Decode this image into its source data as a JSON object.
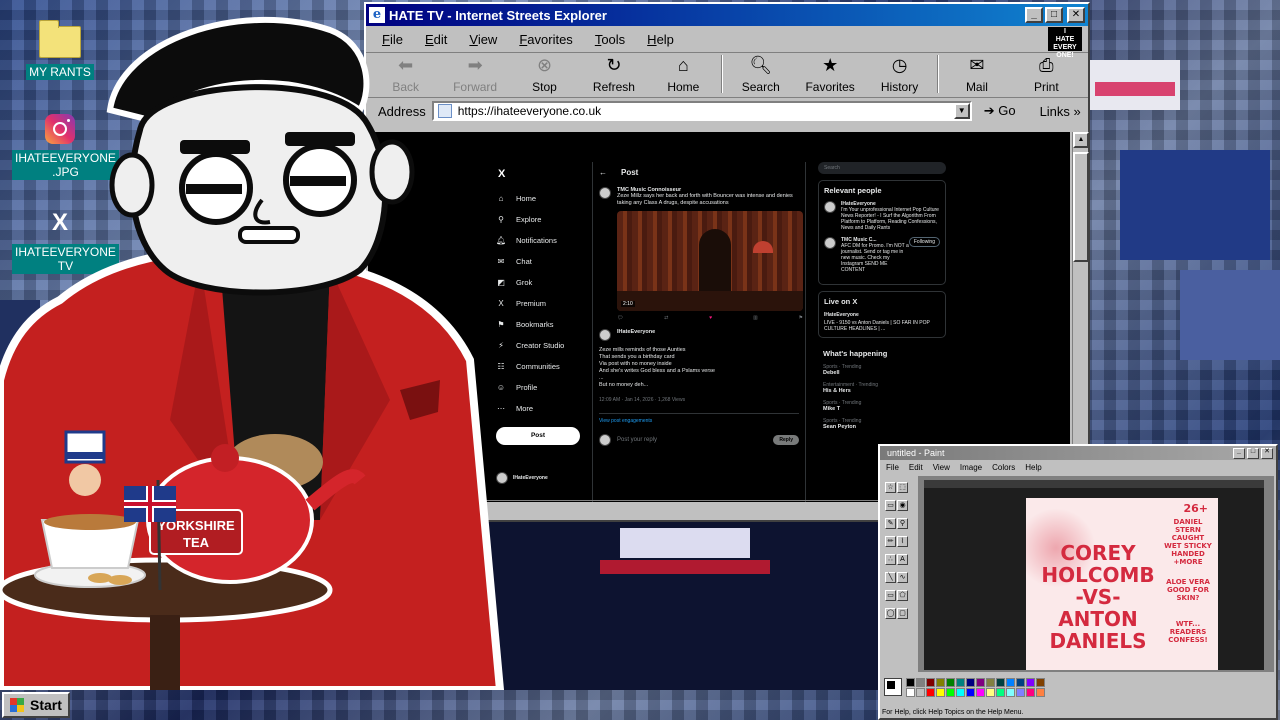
{
  "desktop": {
    "icons": [
      {
        "label": "MY RANTS",
        "icon": "folder-icon"
      },
      {
        "label": "IHATEEVERYONE\n.JPG",
        "icon": "instagram-icon"
      },
      {
        "label": "IHATEEVERYONE\nTV",
        "icon": "x-icon"
      }
    ]
  },
  "ie": {
    "title": "HATE TV - Internet Streets Explorer",
    "menu": [
      "File",
      "Edit",
      "View",
      "Favorites",
      "Tools",
      "Help"
    ],
    "toolbar": {
      "back": "Back",
      "forward": "Forward",
      "stop": "Stop",
      "refresh": "Refresh",
      "home": "Home",
      "search": "Search",
      "favorites": "Favorites",
      "history": "History",
      "mail": "Mail",
      "print": "Print"
    },
    "address_label": "Address",
    "url": "https://ihateeveryone.co.uk",
    "go": "Go",
    "links": "Links"
  },
  "x": {
    "sidebar": [
      "Home",
      "Explore",
      "Notifications",
      "Chat",
      "Grok",
      "Premium",
      "Bookmarks",
      "Creator Studio",
      "Communities",
      "Profile",
      "More"
    ],
    "post_button": "Post",
    "header": "Post",
    "tweet1": {
      "name": "TMC Music Connoisseur",
      "text": "Zeze Millz says her back and forth with Bouncer was intense and denies taking any Class A drugs, despite accusations",
      "duration": "2:10"
    },
    "tweet2": {
      "name": "IHateEveryone",
      "lines": [
        "Zeze mills reminds of those Aunties",
        "That sends you a birthday card",
        "Via post with no money inside",
        "And she's writes God bless and a Pslams verse",
        "...",
        "But no money deh..."
      ],
      "meta": "12:09 AM · Jan 14, 2026 · 1,268 Views",
      "engagements": "View post engagements"
    },
    "reply_placeholder": "Post your reply",
    "reply_button": "Reply",
    "search_placeholder": "Search",
    "relevant": {
      "title": "Relevant people",
      "people": [
        {
          "name": "IHateEveryone",
          "bio": "I'm Your unprofessional Internet Pop Culture News Reporter! - I Surf the Algorithm From Platform to Platform, Reading Confessions, News and Daily Rants"
        },
        {
          "name": "TMC Music C...",
          "bio": "AFC DM for Promo. I'm NOT a journalist. Send or tag me in new music. Check my Instagram SEND ME CONTENT",
          "follow": "Following"
        }
      ]
    },
    "live": {
      "title": "Live on X",
      "host": "IHateEveryone",
      "text": "LIVE - 9150 vs Anton Daniels | SO FAR IN POP CULTURE HEADLINES | ..."
    },
    "happening": {
      "title": "What's happening",
      "trends": [
        {
          "cat": "Sports · Trending",
          "name": "Debell"
        },
        {
          "cat": "Entertainment · Trending",
          "name": "His & Hers"
        },
        {
          "cat": "Sports · Trending",
          "name": "Mike T"
        },
        {
          "cat": "Sports · Trending",
          "name": "Sean Peyton"
        }
      ]
    }
  },
  "paint": {
    "title": "untitled - Paint",
    "menu": [
      "File",
      "Edit",
      "View",
      "Image",
      "Colors",
      "Help"
    ],
    "status": "For Help, click Help Topics on the Help Menu.",
    "artwork": {
      "tag": "26+",
      "heading": "COREY HOLCOMB -VS- ANTON DANIELS",
      "side_top": "DANIEL STERN CAUGHT WET STICKY HANDED +MORE",
      "side_mid": "ALOE VERA GOOD FOR SKIN?",
      "side_bottom": "WTF... READERS CONFESS!"
    }
  },
  "character": {
    "tea_label": "YORKSHIRE TEA",
    "brand": "IHATE EVERYONE"
  },
  "taskbar": {
    "start": "Start"
  }
}
